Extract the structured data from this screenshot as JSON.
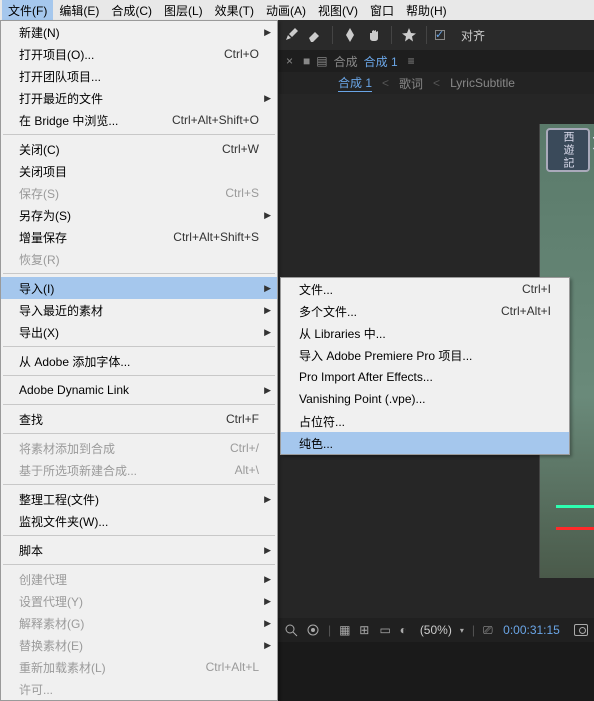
{
  "menubar": {
    "items": [
      {
        "label": "文件(F)"
      },
      {
        "label": "编辑(E)"
      },
      {
        "label": "合成(C)"
      },
      {
        "label": "图层(L)"
      },
      {
        "label": "效果(T)"
      },
      {
        "label": "动画(A)"
      },
      {
        "label": "视图(V)"
      },
      {
        "label": "窗口"
      },
      {
        "label": "帮助(H)"
      }
    ]
  },
  "toolbar": {
    "snap_label": "对齐"
  },
  "comp": {
    "prefix": "合成",
    "name": "合成 1"
  },
  "breadcrumb": {
    "items": [
      "合成 1",
      "歌词",
      "LyricSubtitle"
    ]
  },
  "preview": {
    "logo_text": "西遊記",
    "side_text": "女"
  },
  "statusbar": {
    "zoom": "(50%)",
    "time": "0:00:31:15"
  },
  "file_menu": [
    {
      "type": "item",
      "label": "新建(N)",
      "arrow": true
    },
    {
      "type": "item",
      "label": "打开项目(O)...",
      "shortcut": "Ctrl+O"
    },
    {
      "type": "item",
      "label": "打开团队项目..."
    },
    {
      "type": "item",
      "label": "打开最近的文件",
      "arrow": true
    },
    {
      "type": "item",
      "label": "在 Bridge 中浏览...",
      "shortcut": "Ctrl+Alt+Shift+O"
    },
    {
      "type": "sep"
    },
    {
      "type": "item",
      "label": "关闭(C)",
      "shortcut": "Ctrl+W"
    },
    {
      "type": "item",
      "label": "关闭项目"
    },
    {
      "type": "item",
      "label": "保存(S)",
      "shortcut": "Ctrl+S",
      "disabled": true
    },
    {
      "type": "item",
      "label": "另存为(S)",
      "arrow": true
    },
    {
      "type": "item",
      "label": "增量保存",
      "shortcut": "Ctrl+Alt+Shift+S"
    },
    {
      "type": "item",
      "label": "恢复(R)",
      "disabled": true
    },
    {
      "type": "sep"
    },
    {
      "type": "item",
      "label": "导入(I)",
      "arrow": true,
      "highlight": true
    },
    {
      "type": "item",
      "label": "导入最近的素材",
      "arrow": true
    },
    {
      "type": "item",
      "label": "导出(X)",
      "arrow": true
    },
    {
      "type": "sep"
    },
    {
      "type": "item",
      "label": "从 Adobe 添加字体..."
    },
    {
      "type": "sep"
    },
    {
      "type": "item",
      "label": "Adobe Dynamic Link",
      "arrow": true
    },
    {
      "type": "sep"
    },
    {
      "type": "item",
      "label": "查找",
      "shortcut": "Ctrl+F"
    },
    {
      "type": "sep"
    },
    {
      "type": "item",
      "label": "将素材添加到合成",
      "shortcut": "Ctrl+/",
      "disabled": true
    },
    {
      "type": "item",
      "label": "基于所选项新建合成...",
      "shortcut": "Alt+\\",
      "disabled": true
    },
    {
      "type": "sep"
    },
    {
      "type": "item",
      "label": "整理工程(文件)",
      "arrow": true
    },
    {
      "type": "item",
      "label": "监视文件夹(W)..."
    },
    {
      "type": "sep"
    },
    {
      "type": "item",
      "label": "脚本",
      "arrow": true
    },
    {
      "type": "sep"
    },
    {
      "type": "item",
      "label": "创建代理",
      "arrow": true,
      "disabled": true
    },
    {
      "type": "item",
      "label": "设置代理(Y)",
      "arrow": true,
      "disabled": true
    },
    {
      "type": "item",
      "label": "解释素材(G)",
      "arrow": true,
      "disabled": true
    },
    {
      "type": "item",
      "label": "替换素材(E)",
      "arrow": true,
      "disabled": true
    },
    {
      "type": "item",
      "label": "重新加载素材(L)",
      "shortcut": "Ctrl+Alt+L",
      "disabled": true
    },
    {
      "type": "item",
      "label": "许可...",
      "disabled": true
    }
  ],
  "import_submenu": [
    {
      "type": "item",
      "label": "文件...",
      "shortcut": "Ctrl+I"
    },
    {
      "type": "item",
      "label": "多个文件...",
      "shortcut": "Ctrl+Alt+I"
    },
    {
      "type": "item",
      "label": "从 Libraries 中..."
    },
    {
      "type": "item",
      "label": "导入 Adobe Premiere Pro 项目..."
    },
    {
      "type": "item",
      "label": "Pro Import After Effects..."
    },
    {
      "type": "item",
      "label": "Vanishing Point (.vpe)..."
    },
    {
      "type": "item",
      "label": "占位符..."
    },
    {
      "type": "item",
      "label": "纯色...",
      "highlight": true
    }
  ]
}
